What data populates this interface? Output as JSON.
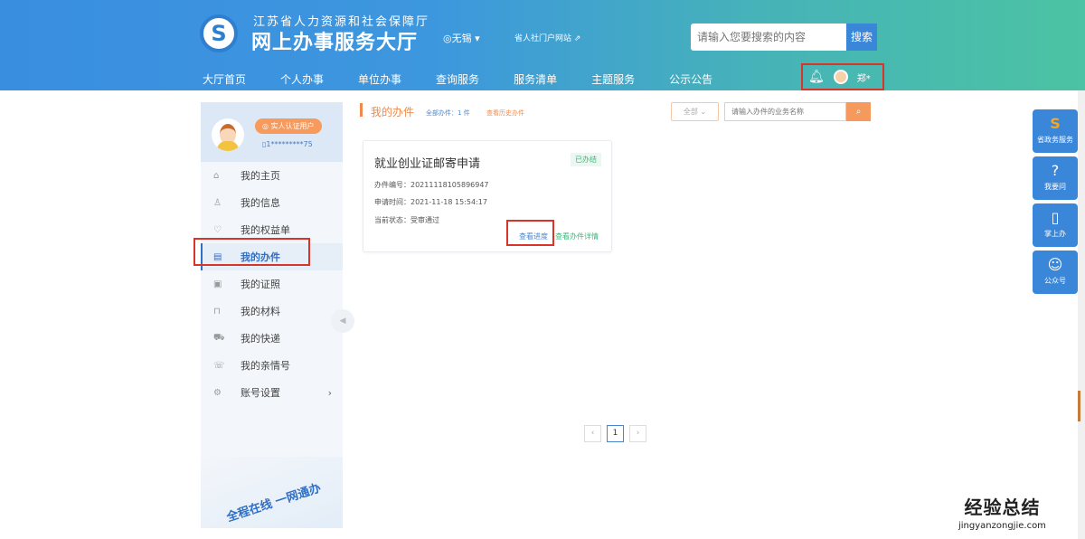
{
  "header": {
    "org": "江苏省人力资源和社会保障厅",
    "title": "网上办事服务大厅",
    "city": "◎无锡 ▾",
    "portal": "省人社门户网站 ⇗",
    "search_placeholder": "请输入您要搜索的内容",
    "search_button": "搜索",
    "logo": "S"
  },
  "nav": [
    "大厅首页",
    "个人办事",
    "单位办事",
    "查询服务",
    "服务清单",
    "主题服务",
    "公示公告"
  ],
  "user": {
    "name": "郑*"
  },
  "profile": {
    "badge": "◎ 实人认证用户",
    "phone": "▯1*********75"
  },
  "sidebar": [
    {
      "icon": "⌂",
      "label": "我的主页"
    },
    {
      "icon": "♙",
      "label": "我的信息"
    },
    {
      "icon": "♡",
      "label": "我的权益单"
    },
    {
      "icon": "▤",
      "label": "我的办件"
    },
    {
      "icon": "▣",
      "label": "我的证照"
    },
    {
      "icon": "⊓",
      "label": "我的材料"
    },
    {
      "icon": "⛟",
      "label": "我的快递"
    },
    {
      "icon": "☏",
      "label": "我的亲情号"
    },
    {
      "icon": "⚙",
      "label": "账号设置"
    }
  ],
  "illustration_text": "全程在线 一网通办",
  "main": {
    "section_title": "我的办件",
    "total": "全部办件：1 件",
    "history": "查看历史办件",
    "filter": "全部 ⌄",
    "keyword_placeholder": "请输入办件的业务名称"
  },
  "card": {
    "title": "就业创业证邮寄申请",
    "status": "已办结",
    "number": "办件编号：20211118105896947",
    "time": "申请时间：2021-11-18 15:54:17",
    "state": "当前状态：受审通过",
    "progress_link": "查看进度",
    "detail_link": "查看办件详情"
  },
  "pager": {
    "prev": "‹",
    "page": "1",
    "next": "›"
  },
  "float": [
    {
      "icon": "S",
      "label": "省政务服务"
    },
    {
      "icon": "?",
      "label": "我要问"
    },
    {
      "icon": "▯",
      "label": "掌上办"
    },
    {
      "icon": "☺",
      "label": "公众号"
    }
  ],
  "watermark": {
    "title": "经验总结",
    "url": "jingyanzongjie.com"
  }
}
